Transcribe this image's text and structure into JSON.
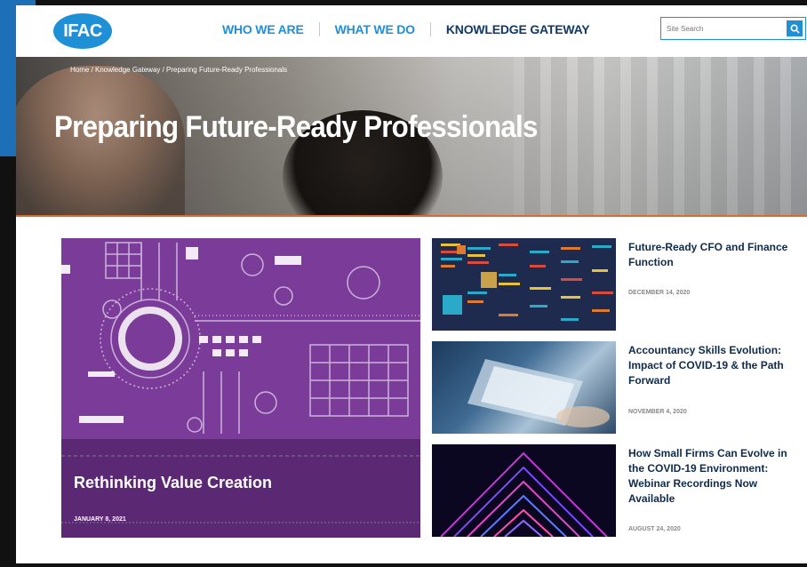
{
  "logo": {
    "text": "IFAC"
  },
  "nav": {
    "items": [
      {
        "label": "WHO WE ARE"
      },
      {
        "label": "WHAT WE DO"
      },
      {
        "label": "KNOWLEDGE GATEWAY"
      }
    ]
  },
  "search": {
    "placeholder": "Site Search",
    "icon": "search-icon"
  },
  "hero": {
    "breadcrumb": "Home / Knowledge Gateway / Preparing Future-Ready Professionals",
    "title": "Preparing Future-Ready Professionals"
  },
  "feature": {
    "title": "Rethinking Value Creation",
    "date": "JANUARY 8, 2021"
  },
  "articles": [
    {
      "title": "Future-Ready CFO and Finance Function",
      "date": "DECEMBER 14, 2020"
    },
    {
      "title": "Accountancy Skills Evolution: Impact of COVID-19 & the Path Forward",
      "date": "NOVEMBER 4, 2020"
    },
    {
      "title": "How Small Firms Can Evolve in the COVID-19 Environment: Webinar Recordings Now Available",
      "date": "AUGUST 24, 2020"
    }
  ],
  "colors": {
    "brand_blue": "#1f8fd6",
    "navy": "#0f3a66",
    "accent_orange": "#e06a2a",
    "feature_purple": "#7b3b99"
  }
}
